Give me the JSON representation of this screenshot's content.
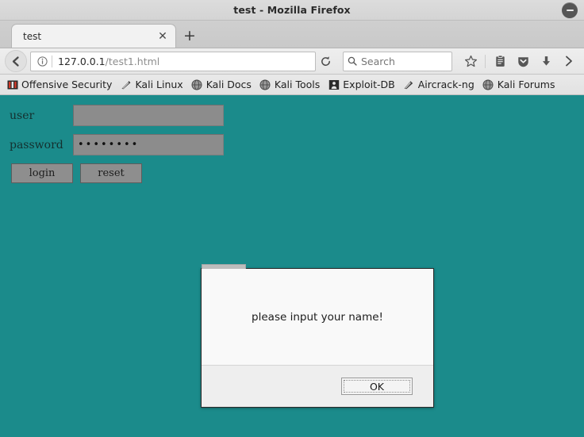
{
  "window": {
    "title": "test - Mozilla Firefox",
    "close_icon": "minimize-circle-icon"
  },
  "tabs": [
    {
      "label": "test",
      "close_icon": "close-icon"
    }
  ],
  "newtab": {
    "label": "+",
    "icon": "plus-icon"
  },
  "nav": {
    "back_icon": "back-arrow-icon",
    "identity_icon": "info-circle-icon",
    "url_host": "127.0.0.1",
    "url_path": "/test1.html",
    "reload_icon": "reload-icon",
    "search": {
      "icon": "search-icon",
      "placeholder": "Search",
      "value": ""
    },
    "icons": [
      {
        "name": "star-icon",
        "title": "Bookmark this page"
      },
      {
        "name": "library-icon",
        "title": "Show your library"
      },
      {
        "name": "pocket-icon",
        "title": "Save to Pocket"
      },
      {
        "name": "download-icon",
        "title": "Downloads"
      },
      {
        "name": "chevron-right-icon",
        "title": "More tools"
      }
    ]
  },
  "bookmarks": [
    {
      "label": "Offensive Security",
      "icon": "offensive-security-icon"
    },
    {
      "label": "Kali Linux",
      "icon": "kali-dragon-icon"
    },
    {
      "label": "Kali Docs",
      "icon": "globe-icon"
    },
    {
      "label": "Kali Tools",
      "icon": "globe-icon"
    },
    {
      "label": "Exploit-DB",
      "icon": "exploit-db-icon"
    },
    {
      "label": "Aircrack-ng",
      "icon": "aircrack-icon"
    },
    {
      "label": "Kali Forums",
      "icon": "globe-icon"
    }
  ],
  "page": {
    "background_color": "#1b8b8b",
    "form": {
      "user": {
        "label": "user",
        "value": "",
        "placeholder": ""
      },
      "password": {
        "label": "password",
        "value": "••••••••",
        "placeholder": ""
      },
      "buttons": [
        {
          "label": "login",
          "name": "login-button"
        },
        {
          "label": "reset",
          "name": "reset-button"
        }
      ]
    }
  },
  "dialog": {
    "message": "please input your name!",
    "ok_label": "OK"
  }
}
